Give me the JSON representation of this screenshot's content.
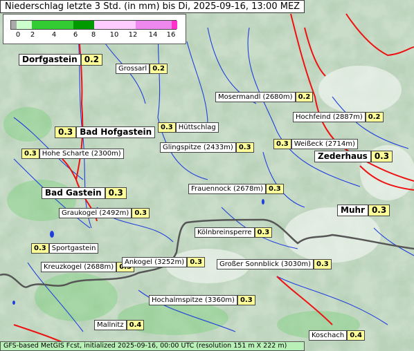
{
  "title": "Niederschlag letzte 3 Std. (in mm) bis Di, 2025-09-16, 13:00 MEZ",
  "legend": {
    "ticks": [
      "0",
      "2",
      "4",
      "6",
      "8",
      "10",
      "12",
      "14",
      "16"
    ],
    "colors": [
      "#aaaaaa",
      "#ccffcc",
      "#33cc33",
      "#009900",
      "#ffccff",
      "#ee88ee",
      "#ff33cc"
    ]
  },
  "places": [
    {
      "name": "Dorfgastein",
      "value": "0.2",
      "big": true,
      "label_first": true
    },
    {
      "name": "Grossarl",
      "value": "0.2",
      "big": false,
      "label_first": true
    },
    {
      "name": "Mosermandl (2680m)",
      "value": "0.2",
      "big": false,
      "label_first": true
    },
    {
      "name": "Hochfeind (2887m)",
      "value": "0.2",
      "big": false,
      "label_first": true
    },
    {
      "name": "Bad Hofgastein",
      "value": "0.3",
      "big": true,
      "label_first": false
    },
    {
      "name": "Hüttschlag",
      "value": "0.3",
      "big": false,
      "label_first": false
    },
    {
      "name": "Glingspitze (2433m)",
      "value": "0.3",
      "big": false,
      "label_first": true
    },
    {
      "name": "Weißeck (2714m)",
      "value": "0.3",
      "big": false,
      "label_first": false
    },
    {
      "name": "Hohe Scharte (2300m)",
      "value": "0.3",
      "big": false,
      "label_first": false
    },
    {
      "name": "Zederhaus",
      "value": "0.3",
      "big": true,
      "label_first": true
    },
    {
      "name": "Frauennock (2678m)",
      "value": "0.3",
      "big": false,
      "label_first": true
    },
    {
      "name": "Bad Gastein",
      "value": "0.3",
      "big": true,
      "label_first": true
    },
    {
      "name": "Muhr",
      "value": "0.3",
      "big": true,
      "label_first": true
    },
    {
      "name": "Graukogel (2492m)",
      "value": "0.3",
      "big": false,
      "label_first": true
    },
    {
      "name": "Kölnbreinsperre",
      "value": "0.3",
      "big": false,
      "label_first": true
    },
    {
      "name": "Sportgastein",
      "value": "0.3",
      "big": false,
      "label_first": false
    },
    {
      "name": "Kreuzkogel (2688m)",
      "value": "0.3",
      "big": false,
      "label_first": true
    },
    {
      "name": "Ankogel (3252m)",
      "value": "0.3",
      "big": false,
      "label_first": true
    },
    {
      "name": "Großer Sonnblick (3030m)",
      "value": "0.3",
      "big": false,
      "label_first": true
    },
    {
      "name": "Hochalmspitze (3360m)",
      "value": "0.3",
      "big": false,
      "label_first": true
    },
    {
      "name": "Mallnitz",
      "value": "0.4",
      "big": false,
      "label_first": true
    },
    {
      "name": "Koschach",
      "value": "0.4",
      "big": false,
      "label_first": true
    }
  ],
  "footer": "GFS-based MetGIS Fcst, initialized 2025-09-16, 00:00 UTC  (resolution 151 m X 222 m)",
  "colors": {
    "terrain_light": "#d8e8d8",
    "terrain_dark": "#7ea07e",
    "rivers": "#1f3fdd",
    "roads": "#ee1111",
    "border": "#555555"
  }
}
